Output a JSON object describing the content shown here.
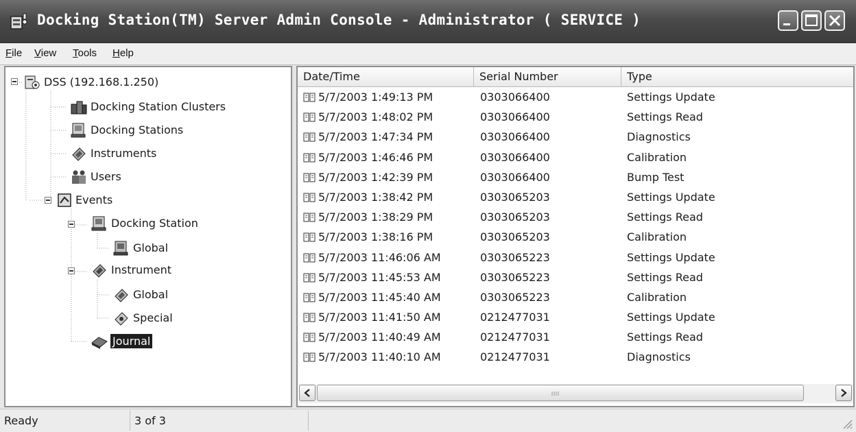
{
  "window": {
    "title": "Docking Station(TM) Server Admin Console - Administrator ( SERVICE )"
  },
  "menu": [
    "File",
    "View",
    "Tools",
    "Help"
  ],
  "tree": {
    "root": "DSS (192.168.1.250)",
    "nodes": {
      "clusters": "Docking Station Clusters",
      "stations": "Docking Stations",
      "instruments": "Instruments",
      "users": "Users",
      "events": "Events",
      "docking_station": "Docking Station",
      "ds_global": "Global",
      "instrument": "Instrument",
      "inst_global": "Global",
      "special": "Special",
      "journal": "Journal"
    },
    "selected": "Journal"
  },
  "list": {
    "columns": [
      "Date/Time",
      "Serial Number",
      "Type"
    ],
    "rows": [
      {
        "datetime": "5/7/2003 1:49:13 PM",
        "serial": "0303066400",
        "type": "Settings Update"
      },
      {
        "datetime": "5/7/2003 1:48:02 PM",
        "serial": "0303066400",
        "type": "Settings Read"
      },
      {
        "datetime": "5/7/2003 1:47:34 PM",
        "serial": "0303066400",
        "type": "Diagnostics"
      },
      {
        "datetime": "5/7/2003 1:46:46 PM",
        "serial": "0303066400",
        "type": "Calibration"
      },
      {
        "datetime": "5/7/2003 1:42:39 PM",
        "serial": "0303066400",
        "type": "Bump Test"
      },
      {
        "datetime": "5/7/2003 1:38:42 PM",
        "serial": "0303065203",
        "type": "Settings Update"
      },
      {
        "datetime": "5/7/2003 1:38:29 PM",
        "serial": "0303065203",
        "type": "Settings Read"
      },
      {
        "datetime": "5/7/2003 1:38:16 PM",
        "serial": "0303065203",
        "type": "Calibration"
      },
      {
        "datetime": "5/7/2003 11:46:06 AM",
        "serial": "0303065223",
        "type": "Settings Update"
      },
      {
        "datetime": "5/7/2003 11:45:53 AM",
        "serial": "0303065223",
        "type": "Settings Read"
      },
      {
        "datetime": "5/7/2003 11:45:40 AM",
        "serial": "0303065223",
        "type": "Calibration"
      },
      {
        "datetime": "5/7/2003 11:41:50 AM",
        "serial": "0212477031",
        "type": "Settings Update"
      },
      {
        "datetime": "5/7/2003 11:40:49 AM",
        "serial": "0212477031",
        "type": "Settings Read"
      },
      {
        "datetime": "5/7/2003 11:40:10 AM",
        "serial": "0212477031",
        "type": "Diagnostics"
      }
    ]
  },
  "status": {
    "state": "Ready",
    "count": "3 of 3"
  },
  "icons": {
    "row": "journal-book-icon",
    "app": "docking-station-app-icon"
  }
}
